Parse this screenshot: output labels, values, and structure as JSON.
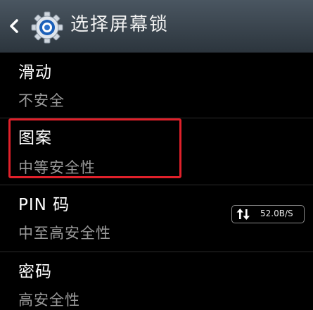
{
  "header": {
    "title": "选择屏幕锁",
    "back_icon": "chevron-left-icon",
    "app_icon": "gear-icon"
  },
  "options": [
    {
      "label": "滑动",
      "sub": "不安全"
    },
    {
      "label": "图案",
      "sub": "中等安全性"
    },
    {
      "label": "PIN 码",
      "sub": "中至高安全性"
    },
    {
      "label": "密码",
      "sub": "高安全性"
    }
  ],
  "highlight": {
    "target": "图案",
    "color": "#e0202a"
  },
  "network_badge": {
    "icon": "up-down-arrows-icon",
    "speed": "52.0B/S"
  }
}
